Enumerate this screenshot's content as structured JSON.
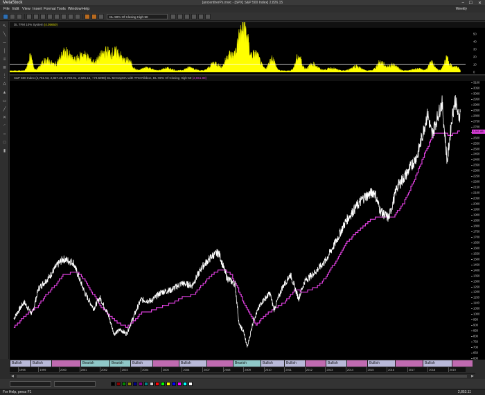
{
  "window": {
    "app_name": "MetaStock",
    "title": "[ancientherPs.mwc - [SPX] S&P 500 Index] 2,826.15",
    "minimize": "–",
    "maximize": "☐",
    "close": "✕"
  },
  "menu": [
    "File",
    "Edit",
    "View",
    "Insert",
    "Format",
    "Tools",
    "Window",
    "Help"
  ],
  "periodicity": "Weekly",
  "toolbar": {
    "indicator_combo": "DL-90% Of Closing High-50"
  },
  "indicator_pane": {
    "header_name": "DL TFM 10% System",
    "header_value": "(4.05650)",
    "scale_labels": [
      "50",
      "40",
      "30",
      "20",
      "10",
      "0"
    ],
    "reference_line": 10,
    "color": "#ffff00"
  },
  "price_pane": {
    "header_series": "S&P 500 Index (2,751.53, 2,827.20, 2,728.81, 2,826.15, +74.5998)",
    "header_overlays": "DL-50-DayMA-with TFM Ribbon, DL-90% Of Closing High-50",
    "header_overlay_value": "(2,651.88)",
    "last_value_tag": "2,651.88",
    "scale_labels": [
      "3100",
      "3050",
      "3000",
      "2950",
      "2900",
      "2850",
      "2800",
      "2750",
      "2700",
      "2650",
      "2600",
      "2550",
      "2500",
      "2450",
      "2400",
      "2350",
      "2300",
      "2250",
      "2200",
      "2150",
      "2100",
      "2050",
      "2000",
      "1950",
      "1900",
      "1850",
      "1800",
      "1750",
      "1700",
      "1650",
      "1600",
      "1550",
      "1500",
      "1450",
      "1400",
      "1350",
      "1300",
      "1250",
      "1200",
      "1150",
      "1100",
      "1050",
      "1000",
      "950",
      "900",
      "850",
      "800",
      "750",
      "700",
      "650",
      "600"
    ],
    "price_color": "#ffffff",
    "overlay_color": "#e040e0"
  },
  "sentiment_bar": [
    {
      "label": "Bullish",
      "kind": "bull"
    },
    {
      "label": "Bullish",
      "kind": "bull"
    },
    {
      "label": "",
      "kind": "pink"
    },
    {
      "label": "Bearish",
      "kind": "bear"
    },
    {
      "label": "Bearish",
      "kind": "bear"
    },
    {
      "label": "Bullish",
      "kind": "bull"
    },
    {
      "label": "",
      "kind": "pink"
    },
    {
      "label": "Bullish",
      "kind": "bull"
    },
    {
      "label": "",
      "kind": "pink"
    },
    {
      "label": "Bearish",
      "kind": "bear"
    },
    {
      "label": "Bullish",
      "kind": "bull"
    },
    {
      "label": "Bullish",
      "kind": "bull"
    },
    {
      "label": "",
      "kind": "pink"
    },
    {
      "label": "Bullish",
      "kind": "bull"
    },
    {
      "label": "",
      "kind": "pink"
    },
    {
      "label": "Bullish",
      "kind": "bull"
    },
    {
      "label": "",
      "kind": "pink"
    },
    {
      "label": "Bullish",
      "kind": "bull"
    },
    {
      "label": "",
      "kind": "pink"
    }
  ],
  "years": [
    "1998",
    "1999",
    "2000",
    "2001",
    "2002",
    "2003",
    "2004",
    "2005",
    "2006",
    "2007",
    "2008",
    "2009",
    "2010",
    "2011",
    "2012",
    "2013",
    "2014",
    "2015",
    "2016",
    "2017",
    "2018",
    "2019"
  ],
  "status": {
    "help": "For Help, press F1",
    "value": "2,853.11"
  },
  "chart_data": {
    "type": "line",
    "title": "S&P 500 Index",
    "x": [
      "1998",
      "1999",
      "2000",
      "2001",
      "2002",
      "2003",
      "2004",
      "2005",
      "2006",
      "2007",
      "2008",
      "2009",
      "2010",
      "2011",
      "2012",
      "2013",
      "2014",
      "2015",
      "2016",
      "2017",
      "2018",
      "2019"
    ],
    "ylim": [
      600,
      3100
    ],
    "series": [
      {
        "name": "S&P 500 Index",
        "points": [
          [
            1997.8,
            960
          ],
          [
            1998.3,
            1110
          ],
          [
            1998.7,
            1000
          ],
          [
            1999.0,
            1230
          ],
          [
            1999.5,
            1330
          ],
          [
            1999.9,
            1440
          ],
          [
            2000.2,
            1500
          ],
          [
            2000.7,
            1470
          ],
          [
            2001.0,
            1320
          ],
          [
            2001.3,
            1180
          ],
          [
            2001.7,
            1050
          ],
          [
            2002.0,
            1150
          ],
          [
            2002.4,
            1000
          ],
          [
            2002.7,
            820
          ],
          [
            2003.0,
            860
          ],
          [
            2003.3,
            820
          ],
          [
            2003.7,
            1000
          ],
          [
            2004.0,
            1130
          ],
          [
            2004.5,
            1120
          ],
          [
            2005.0,
            1200
          ],
          [
            2005.5,
            1220
          ],
          [
            2006.0,
            1280
          ],
          [
            2006.5,
            1260
          ],
          [
            2007.0,
            1430
          ],
          [
            2007.5,
            1530
          ],
          [
            2007.8,
            1560
          ],
          [
            2008.2,
            1330
          ],
          [
            2008.6,
            1270
          ],
          [
            2008.8,
            900
          ],
          [
            2009.0,
            850
          ],
          [
            2009.2,
            700
          ],
          [
            2009.5,
            950
          ],
          [
            2009.9,
            1110
          ],
          [
            2010.3,
            1190
          ],
          [
            2010.5,
            1040
          ],
          [
            2010.9,
            1240
          ],
          [
            2011.3,
            1360
          ],
          [
            2011.7,
            1140
          ],
          [
            2012.0,
            1300
          ],
          [
            2012.5,
            1380
          ],
          [
            2013.0,
            1480
          ],
          [
            2013.5,
            1650
          ],
          [
            2014.0,
            1840
          ],
          [
            2014.5,
            1970
          ],
          [
            2014.9,
            2060
          ],
          [
            2015.4,
            2110
          ],
          [
            2015.7,
            1930
          ],
          [
            2016.1,
            1870
          ],
          [
            2016.5,
            2150
          ],
          [
            2017.0,
            2280
          ],
          [
            2017.5,
            2440
          ],
          [
            2018.0,
            2820
          ],
          [
            2018.2,
            2620
          ],
          [
            2018.7,
            2920
          ],
          [
            2018.95,
            2380
          ],
          [
            2019.2,
            2800
          ],
          [
            2019.35,
            2950
          ],
          [
            2019.5,
            2780
          ],
          [
            2019.6,
            2830
          ]
        ]
      },
      {
        "name": "DL-90% Of Closing High-50",
        "points": [
          [
            1997.8,
            880
          ],
          [
            1998.4,
            1000
          ],
          [
            1998.9,
            1060
          ],
          [
            1999.4,
            1180
          ],
          [
            1999.9,
            1280
          ],
          [
            2000.2,
            1360
          ],
          [
            2000.9,
            1380
          ],
          [
            2001.2,
            1320
          ],
          [
            2001.6,
            1200
          ],
          [
            2002.0,
            1080
          ],
          [
            2002.4,
            1000
          ],
          [
            2002.8,
            930
          ],
          [
            2003.3,
            880
          ],
          [
            2003.6,
            930
          ],
          [
            2004.0,
            1010
          ],
          [
            2004.5,
            1030
          ],
          [
            2005.0,
            1070
          ],
          [
            2005.5,
            1100
          ],
          [
            2006.0,
            1150
          ],
          [
            2006.6,
            1180
          ],
          [
            2007.0,
            1270
          ],
          [
            2007.6,
            1380
          ],
          [
            2008.0,
            1410
          ],
          [
            2008.4,
            1360
          ],
          [
            2008.7,
            1240
          ],
          [
            2009.0,
            1110
          ],
          [
            2009.3,
            1000
          ],
          [
            2009.6,
            900
          ],
          [
            2010.0,
            980
          ],
          [
            2010.5,
            1050
          ],
          [
            2011.0,
            1110
          ],
          [
            2011.5,
            1220
          ],
          [
            2012.0,
            1200
          ],
          [
            2012.6,
            1250
          ],
          [
            2013.0,
            1330
          ],
          [
            2013.5,
            1480
          ],
          [
            2014.0,
            1640
          ],
          [
            2014.6,
            1760
          ],
          [
            2015.2,
            1860
          ],
          [
            2015.8,
            1890
          ],
          [
            2016.3,
            1880
          ],
          [
            2016.8,
            2000
          ],
          [
            2017.3,
            2200
          ],
          [
            2017.9,
            2480
          ],
          [
            2018.3,
            2640
          ],
          [
            2018.8,
            2640
          ],
          [
            2019.1,
            2620
          ],
          [
            2019.4,
            2650
          ],
          [
            2019.6,
            2652
          ]
        ]
      }
    ]
  }
}
